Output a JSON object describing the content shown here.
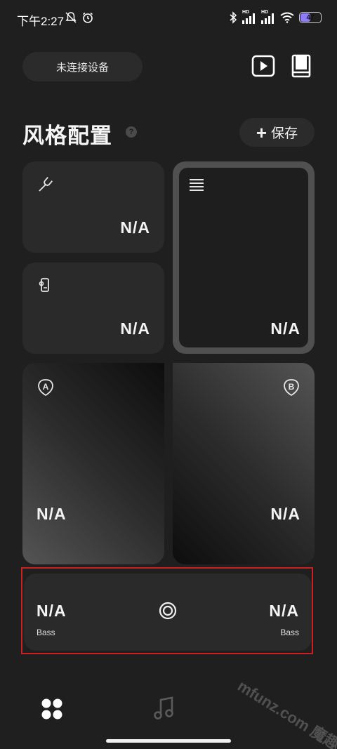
{
  "status_bar": {
    "time": "下午2:27",
    "battery_level": "47",
    "battery_fraction": 0.47,
    "hd_label_1": "HD",
    "hd_label_2": "HD"
  },
  "header": {
    "device_status": "未连接设备"
  },
  "section": {
    "title": "风格配置",
    "help_glyph": "?",
    "save_label": "保存",
    "save_plus": "+"
  },
  "cards": {
    "tuning": {
      "icon": "tuning-fork-icon",
      "value": "N/A"
    },
    "pickup": {
      "icon": "pickup-icon",
      "value": "N/A"
    },
    "equalizer": {
      "icon": "equalizer-lines-icon",
      "value": "N/A"
    },
    "preset_a": {
      "icon": "badge-a-icon",
      "badge": "A",
      "value": "N/A"
    },
    "preset_b": {
      "icon": "badge-b-icon",
      "badge": "B",
      "value": "N/A"
    }
  },
  "bass_card": {
    "left_value": "N/A",
    "left_label": "Bass",
    "right_value": "N/A",
    "right_label": "Bass",
    "center_icon": "target-circle-icon"
  },
  "bottom_nav": {
    "items": [
      {
        "name": "grid",
        "icon": "four-dots-icon",
        "active": true
      },
      {
        "name": "music",
        "icon": "music-note-icon",
        "active": false
      }
    ]
  },
  "watermark": "mfunz.com 魔趣网",
  "colors": {
    "background": "#1f1f1f",
    "card": "#2a2a2a",
    "highlight": "#cc1f1f",
    "battery_accent": "#8e7cff"
  }
}
